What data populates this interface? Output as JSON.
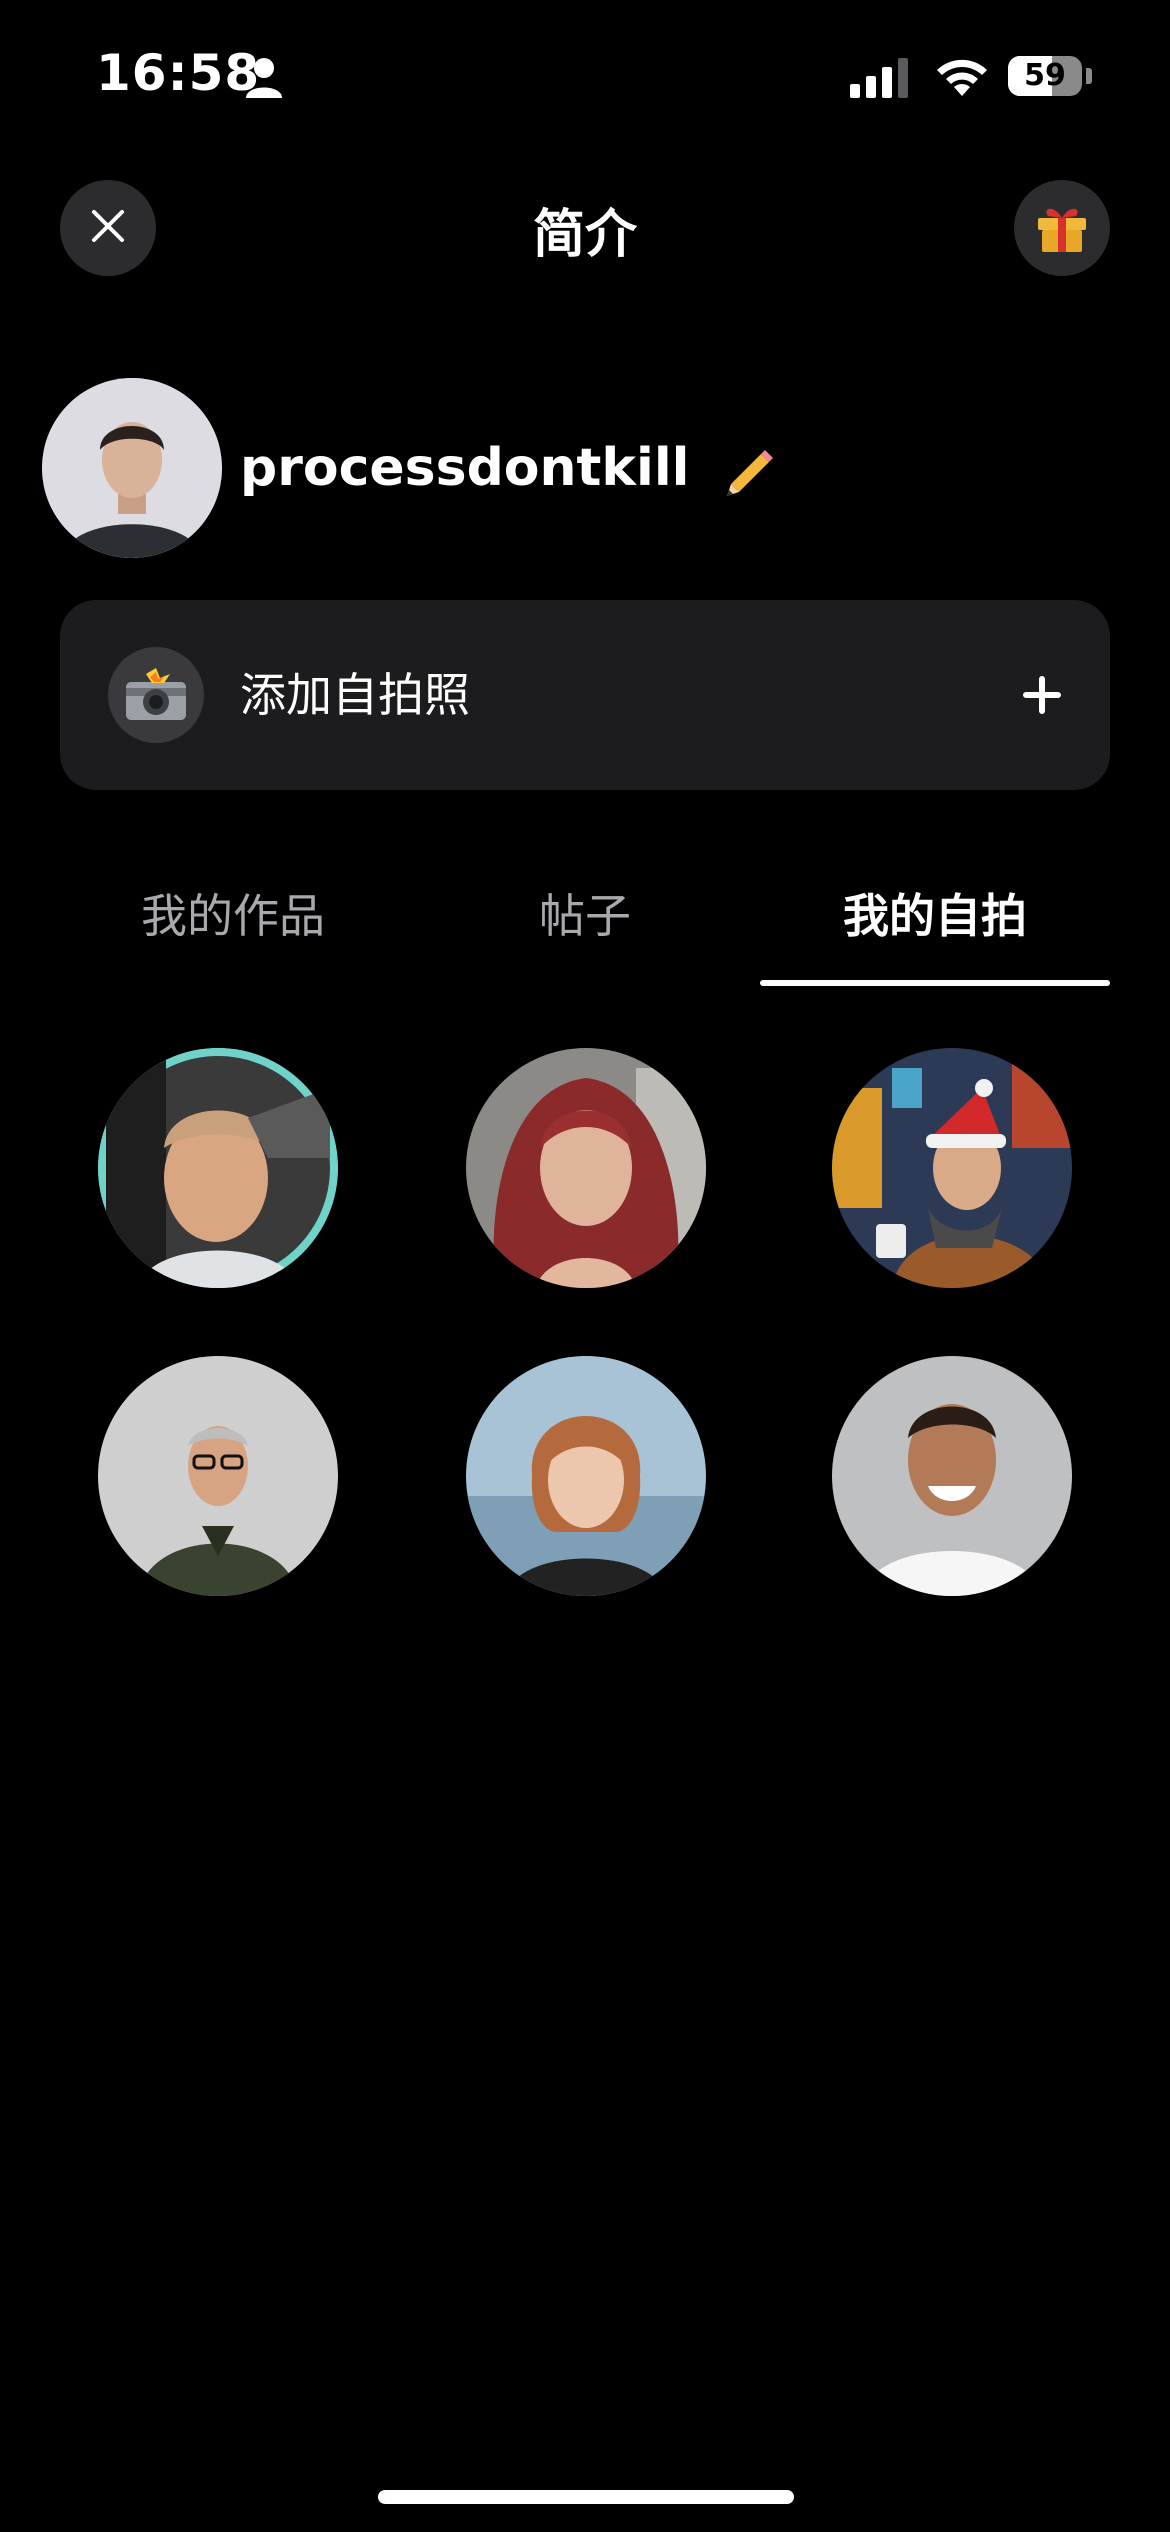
{
  "status_bar": {
    "time": "16:58",
    "battery": "59",
    "battery_level": 0.59,
    "icons": [
      "person-icon",
      "cellular-signal-icon",
      "wifi-icon",
      "battery-icon"
    ]
  },
  "header": {
    "title": "简介",
    "close_icon": "close-icon",
    "gift_icon": "gift-icon"
  },
  "profile": {
    "username": "processdontkill",
    "edit_icon": "pencil-icon"
  },
  "add_selfie": {
    "label": "添加自拍照",
    "icon": "camera-flash-icon",
    "action_icon": "plus-icon"
  },
  "tabs": [
    {
      "label": "我的作品",
      "active": false
    },
    {
      "label": "帖子",
      "active": false
    },
    {
      "label": "我的自拍",
      "active": true
    }
  ],
  "selfies": [
    {
      "selected": true
    },
    {
      "selected": false
    },
    {
      "selected": false
    },
    {
      "selected": false
    },
    {
      "selected": false
    },
    {
      "selected": false
    }
  ],
  "colors": {
    "background": "#000000",
    "card": "#1c1c1e",
    "button": "#2c2c2e",
    "selected_ring": "#6fd3c9",
    "inactive_tab": "#a8a8ad"
  }
}
